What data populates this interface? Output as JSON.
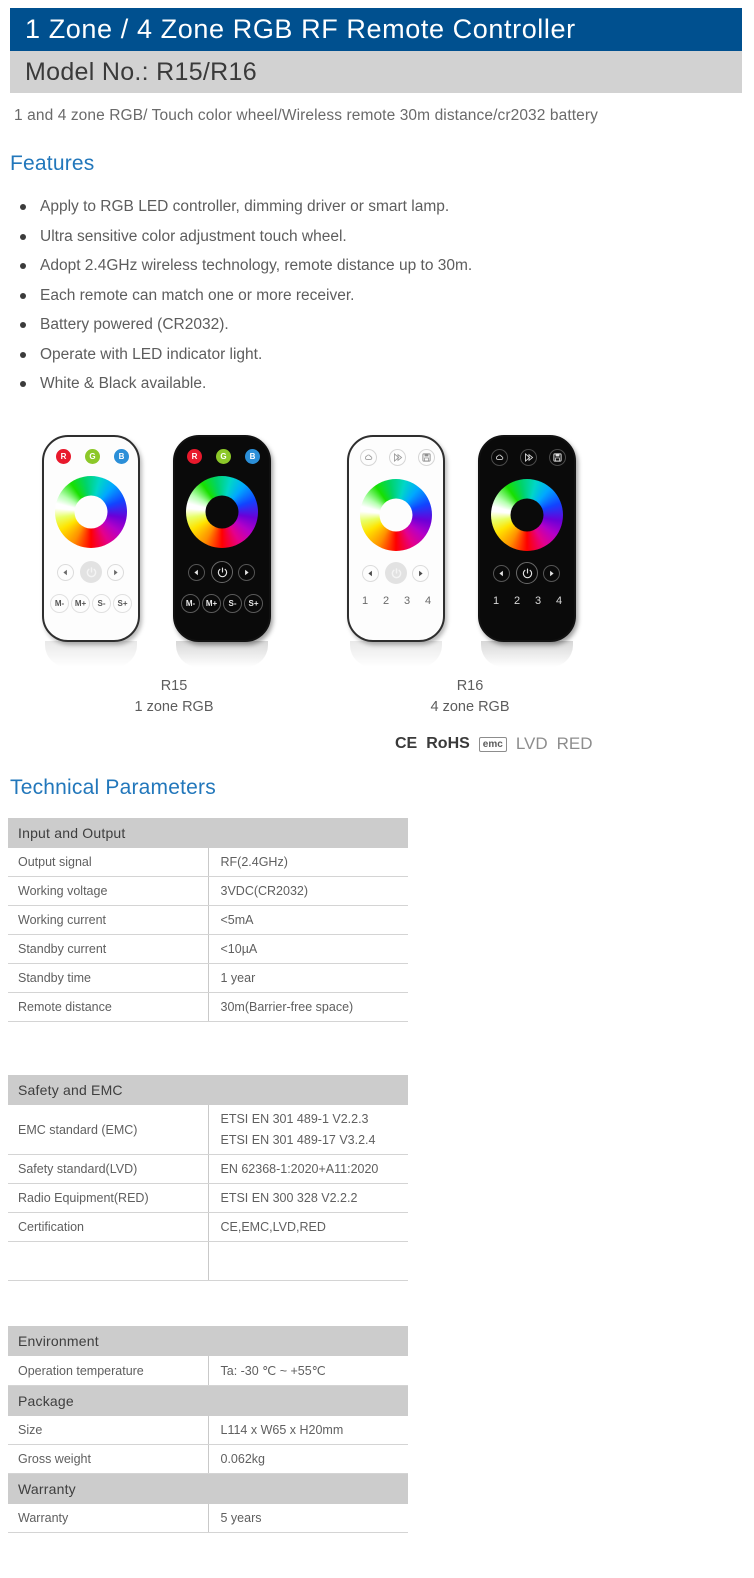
{
  "header": {
    "title": "1 Zone / 4 Zone RGB RF Remote Controller",
    "model": "Model No.: R15/R16",
    "subtitle": "1 and 4 zone RGB/ Touch color wheel/Wireless remote 30m distance/cr2032 battery",
    "title_bar_color": "#00508f",
    "model_bar_color": "#d2d2d2"
  },
  "features": {
    "heading": "Features",
    "items": [
      "Apply to RGB LED controller, dimming driver or smart lamp.",
      "Ultra sensitive color adjustment touch wheel.",
      "Adopt 2.4GHz wireless technology, remote distance up to 30m.",
      "Each remote can match one or more receiver.",
      "Battery powered (CR2032).",
      "Operate with LED indicator light.",
      "White & Black available."
    ]
  },
  "products": {
    "r15": {
      "name": "R15",
      "desc": "1 zone RGB",
      "indicators": [
        {
          "label": "R",
          "color": "#e8192c"
        },
        {
          "label": "G",
          "color": "#8cc829"
        },
        {
          "label": "B",
          "color": "#2b8fd8"
        }
      ],
      "mode_buttons": [
        "M-",
        "M+",
        "S-",
        "S+"
      ]
    },
    "r16": {
      "name": "R16",
      "desc": "4 zone RGB",
      "top_icons": [
        "mode-cloud-icon",
        "speed-forward-icon",
        "save-floppy-icon"
      ],
      "zones": [
        "1",
        "2",
        "3",
        "4"
      ]
    },
    "nav_icons": [
      "prev-arrow-icon",
      "power-icon",
      "next-arrow-icon"
    ]
  },
  "certifications": {
    "ce": "CE",
    "rohs": "RoHS",
    "emc": "emc",
    "lvd": "LVD",
    "red": "RED"
  },
  "technical": {
    "heading": "Technical Parameters",
    "tables": [
      {
        "group": "Input and Output",
        "rows": [
          {
            "key": "Output signal",
            "value": "RF(2.4GHz)"
          },
          {
            "key": "Working voltage",
            "value": "3VDC(CR2032)"
          },
          {
            "key": "Working current",
            "value": "<5mA"
          },
          {
            "key": "Standby current",
            "value": "<10µA"
          },
          {
            "key": "Standby time",
            "value": "1 year"
          },
          {
            "key": "Remote distance",
            "value": "30m(Barrier-free space)"
          }
        ]
      },
      {
        "group": "Safety and EMC",
        "rows": [
          {
            "key": "EMC standard (EMC)",
            "value": "ETSI EN 301 489-1 V2.2.3",
            "value2": "ETSI EN 301 489-17 V3.2.4"
          },
          {
            "key": "Safety standard(LVD)",
            "value": "EN 62368-1:2020+A11:2020"
          },
          {
            "key": "Radio Equipment(RED)",
            "value": "ETSI EN 300 328 V2.2.2"
          },
          {
            "key": "Certification",
            "value": "CE,EMC,LVD,RED"
          },
          {
            "key": "",
            "value": ""
          }
        ]
      },
      {
        "group": "Environment",
        "rows": [
          {
            "key": "Operation temperature",
            "value": "Ta: -30 ℃ ~ +55℃"
          }
        ]
      },
      {
        "group": "Package",
        "rows": [
          {
            "key": "Size",
            "value": "L114 x W65 x H20mm"
          },
          {
            "key": "Gross weight",
            "value": "0.062kg"
          }
        ]
      },
      {
        "group": "Warranty",
        "rows": [
          {
            "key": "Warranty",
            "value": "5 years"
          }
        ]
      }
    ]
  }
}
